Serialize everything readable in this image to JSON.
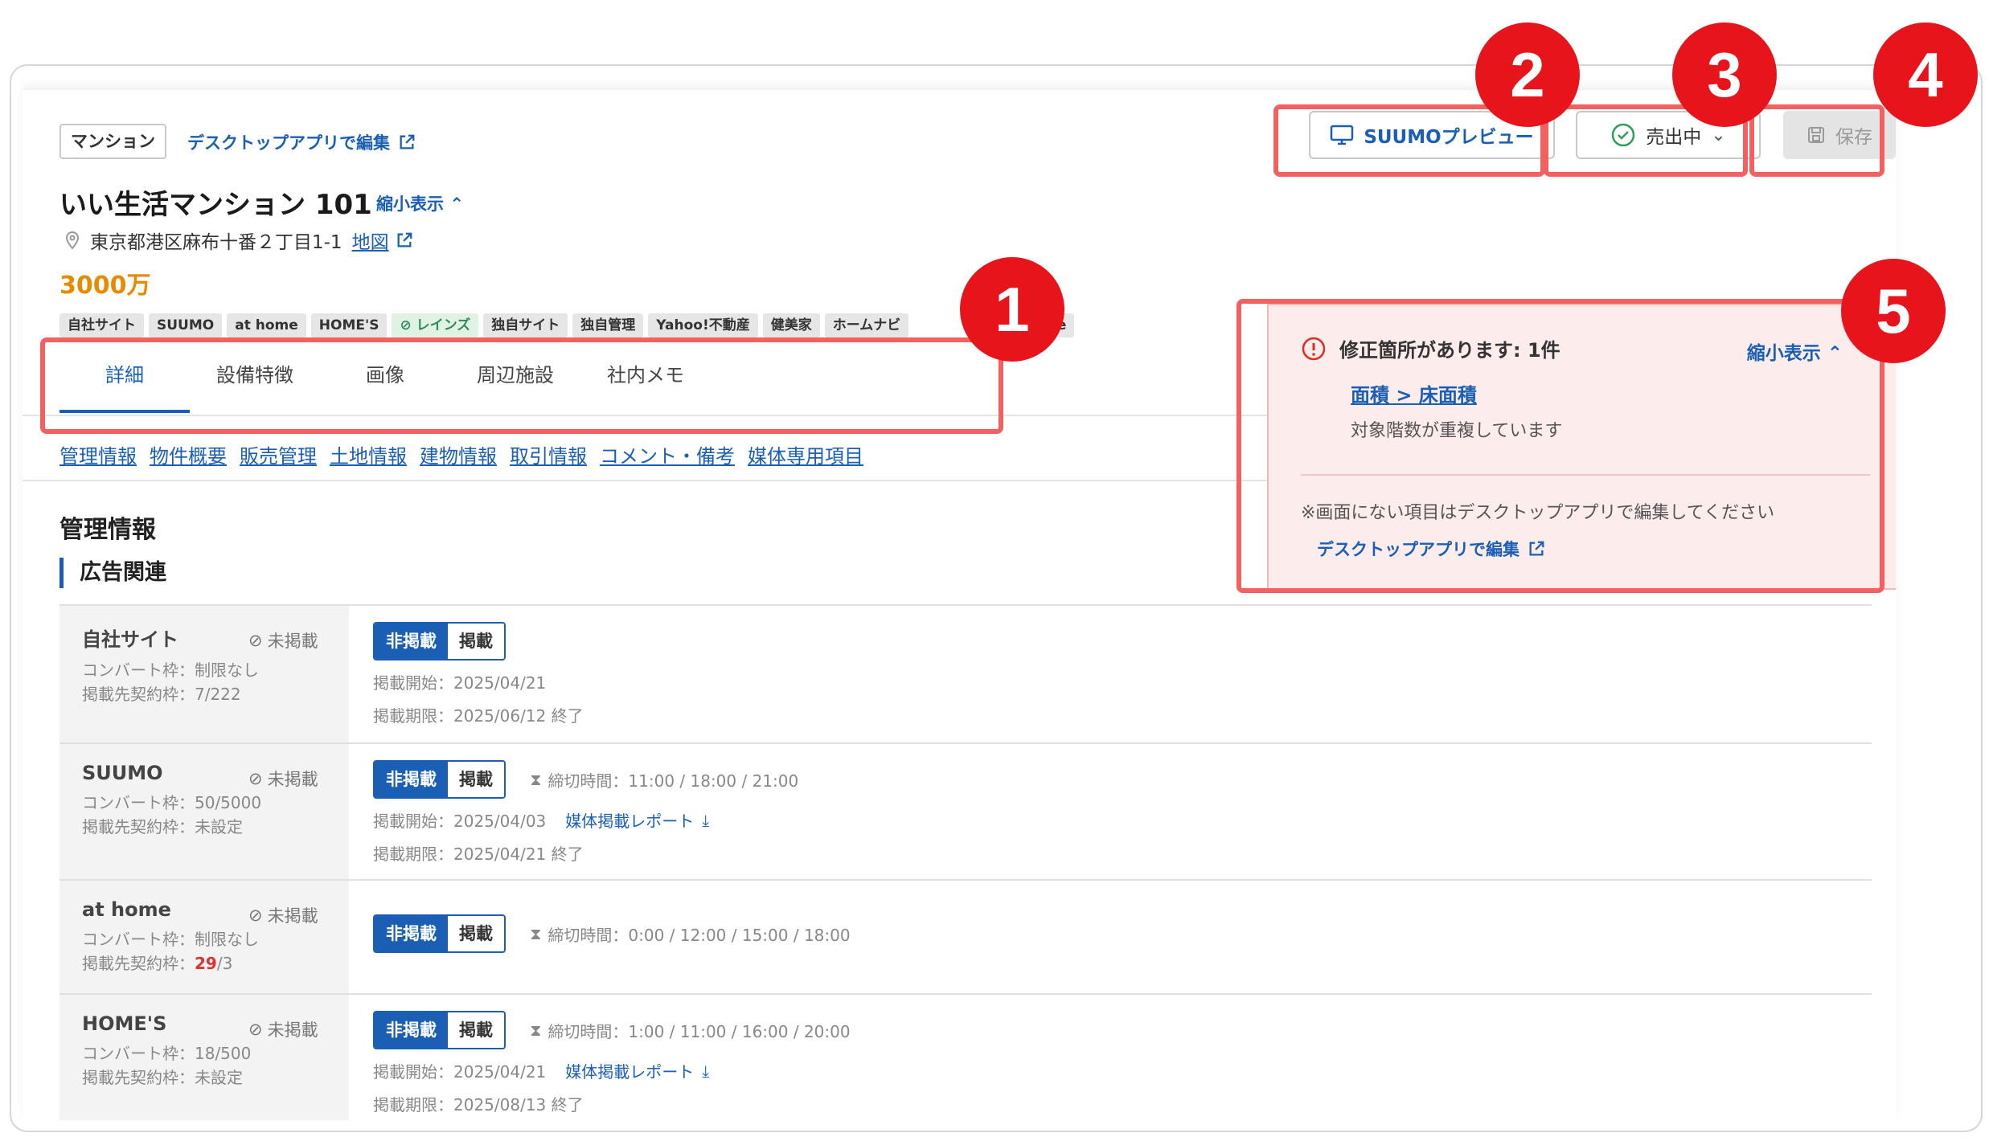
{
  "header": {
    "type_badge": "マンション",
    "desktop_edit": "デスクトップアプリで編集",
    "title": "いい生活マンション 101",
    "shrink": "縮小表示",
    "address": "東京都港区麻布十番２丁目1-1",
    "map": "地図",
    "price": "3000万"
  },
  "tags": [
    {
      "label": "自社サイト"
    },
    {
      "label": "SUUMO"
    },
    {
      "label": "at home"
    },
    {
      "label": "HOME'S"
    },
    {
      "label": "レインズ"
    },
    {
      "label": "独自サイト"
    },
    {
      "label": "独自管理"
    },
    {
      "label": "Yahoo!不動産"
    },
    {
      "label": "健美家"
    },
    {
      "label": "ホームナビ"
    },
    {
      "label": "realestate"
    }
  ],
  "tabs": [
    "詳細",
    "設備特徴",
    "画像",
    "周辺施設",
    "社内メモ"
  ],
  "anchors": [
    "管理情報",
    "物件概要",
    "販売管理",
    "土地情報",
    "建物情報",
    "取引情報",
    "コメント・備考",
    "媒体専用項目"
  ],
  "section": {
    "title": "管理情報",
    "subtitle": "広告関連"
  },
  "rows": [
    {
      "name": "自社サイト",
      "status": "未掲載",
      "convert": "コンバート枠：制限なし",
      "contract": "掲載先契約枠：7/222",
      "on": "非掲載",
      "off": "掲載",
      "start": "掲載開始：2025/04/21",
      "end": "掲載期限：2025/06/12 終了"
    },
    {
      "name": "SUUMO",
      "status": "未掲載",
      "convert": "コンバート枠：50/5000",
      "contract": "掲載先契約枠：未設定",
      "on": "非掲載",
      "off": "掲載",
      "deadline": "締切時間：11:00 / 18:00 / 21:00",
      "start": "掲載開始：2025/04/03",
      "report": "媒体掲載レポート",
      "end": "掲載期限：2025/04/21 終了"
    },
    {
      "name": "at home",
      "status": "未掲載",
      "convert": "コンバート枠：制限なし",
      "contract_prefix": "掲載先契約枠：",
      "contract_red": "29",
      "contract_suffix": "/3",
      "on": "非掲載",
      "off": "掲載",
      "deadline": "締切時間：0:00 / 12:00 / 15:00 / 18:00"
    },
    {
      "name": "HOME'S",
      "status": "未掲載",
      "convert": "コンバート枠：18/500",
      "contract": "掲載先契約枠：未設定",
      "on": "非掲載",
      "off": "掲載",
      "deadline": "締切時間：1:00 / 11:00 / 16:00 / 20:00",
      "start": "掲載開始：2025/04/21",
      "report": "媒体掲載レポート",
      "end": "掲載期限：2025/08/13 終了"
    }
  ],
  "buttons": {
    "suumo": "SUUMOプレビュー",
    "status": "売出中",
    "save": "保存"
  },
  "alert": {
    "title": "修正箇所があります: 1件",
    "shrink": "縮小表示",
    "link": "面積 > 床面積",
    "message": "対象階数が重複しています",
    "note": "※画面にない項目はデスクトップアプリで編集してください",
    "desktop_edit": "デスクトップアプリで編集"
  },
  "callouts": [
    "1",
    "2",
    "3",
    "4",
    "5"
  ],
  "colors": {
    "accent": "#1a5fb4",
    "price": "#e88a00",
    "callout": "#e8141b",
    "highlight": "#f26060"
  }
}
